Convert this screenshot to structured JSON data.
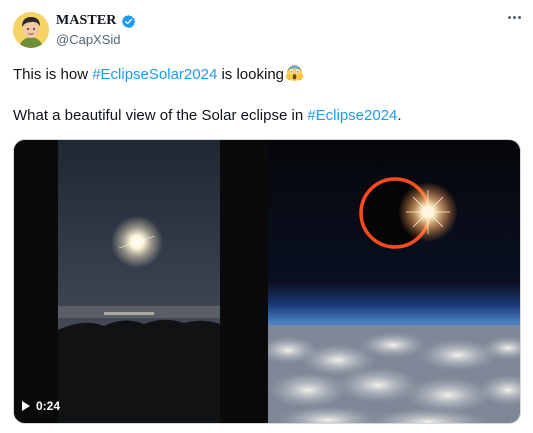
{
  "author": {
    "name": "MASTER",
    "handle": "@CapXSid",
    "verified_color": "#1d9bf0",
    "avatar_icon": "avatar-illustration"
  },
  "more_icon": "more-dots-icon",
  "tweet": {
    "line1_prefix": "This is how ",
    "line1_hashtag": "#EclipseSolar2024",
    "line1_suffix": " is looking",
    "line1_emoji": "scream-emoji",
    "line2_prefix": "What a beautiful view of the Solar eclipse in ",
    "line2_hashtag": "#Eclipse2024",
    "line2_suffix": "."
  },
  "media": {
    "video_duration": "0:24",
    "video_icon": "play-icon"
  },
  "colors": {
    "link": "#1d9bf0",
    "text": "#0f1419",
    "secondary": "#536471",
    "border": "#cfd9de"
  }
}
